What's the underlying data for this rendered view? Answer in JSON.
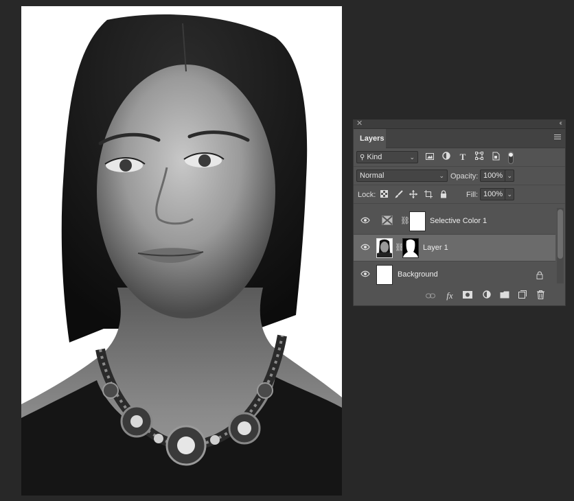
{
  "panel": {
    "tab_label": "Layers",
    "filter": {
      "kind_label": "Kind"
    },
    "blend_mode": "Normal",
    "opacity_label": "Opacity:",
    "opacity_value": "100%",
    "lock_label": "Lock:",
    "fill_label": "Fill:",
    "fill_value": "100%"
  },
  "layers": [
    {
      "name": "Selective Color 1",
      "visible": true,
      "selected": false,
      "type": "adjustment"
    },
    {
      "name": "Layer 1",
      "visible": true,
      "selected": true,
      "type": "pixel-with-mask"
    },
    {
      "name": "Background",
      "visible": true,
      "selected": false,
      "type": "background",
      "locked": true
    }
  ],
  "icons": {
    "close": "close-icon",
    "collapse": "collapse-icon",
    "menu": "panel-menu-icon",
    "filter": [
      "image-filter-icon",
      "adjustment-filter-icon",
      "type-filter-icon",
      "shape-filter-icon",
      "smart-object-filter-icon",
      "filter-toggle-icon"
    ],
    "lock": [
      "lock-transparent-icon",
      "lock-image-icon",
      "lock-position-icon",
      "lock-artboard-icon",
      "lock-all-icon"
    ],
    "bottom": [
      "link-layers-icon",
      "layer-style-icon",
      "add-mask-icon",
      "new-adjustment-icon",
      "new-group-icon",
      "new-layer-icon",
      "delete-layer-icon"
    ]
  },
  "colors": {
    "workspace": "#282828",
    "panel": "#535353",
    "selected_row": "#6b6b6b"
  }
}
